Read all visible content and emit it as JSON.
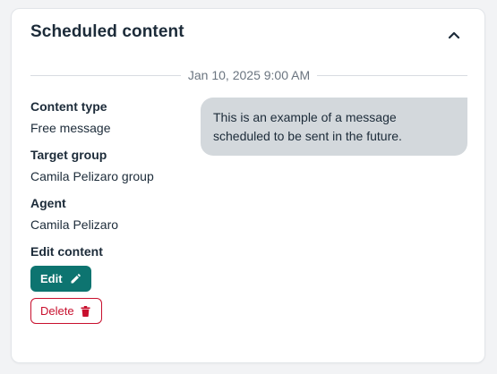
{
  "card": {
    "title": "Scheduled content",
    "scheduled_at": "Jan 10, 2025 9:00 AM"
  },
  "details": {
    "content_type_label": "Content type",
    "content_type_value": "Free message",
    "target_group_label": "Target group",
    "target_group_value": "Camila Pelizaro group",
    "agent_label": "Agent",
    "agent_value": "Camila Pelizaro",
    "edit_content_label": "Edit content"
  },
  "actions": {
    "edit_label": "Edit",
    "delete_label": "Delete"
  },
  "message": {
    "text": "This is an example of a message scheduled to be sent in the future."
  },
  "icons": {
    "collapse": "chevron-up-icon",
    "edit": "pencil-icon",
    "delete": "trash-icon"
  },
  "colors": {
    "primary": "#0d7470",
    "danger": "#c8102e",
    "bubble": "#d3d8dc",
    "text": "#1c2b39"
  }
}
